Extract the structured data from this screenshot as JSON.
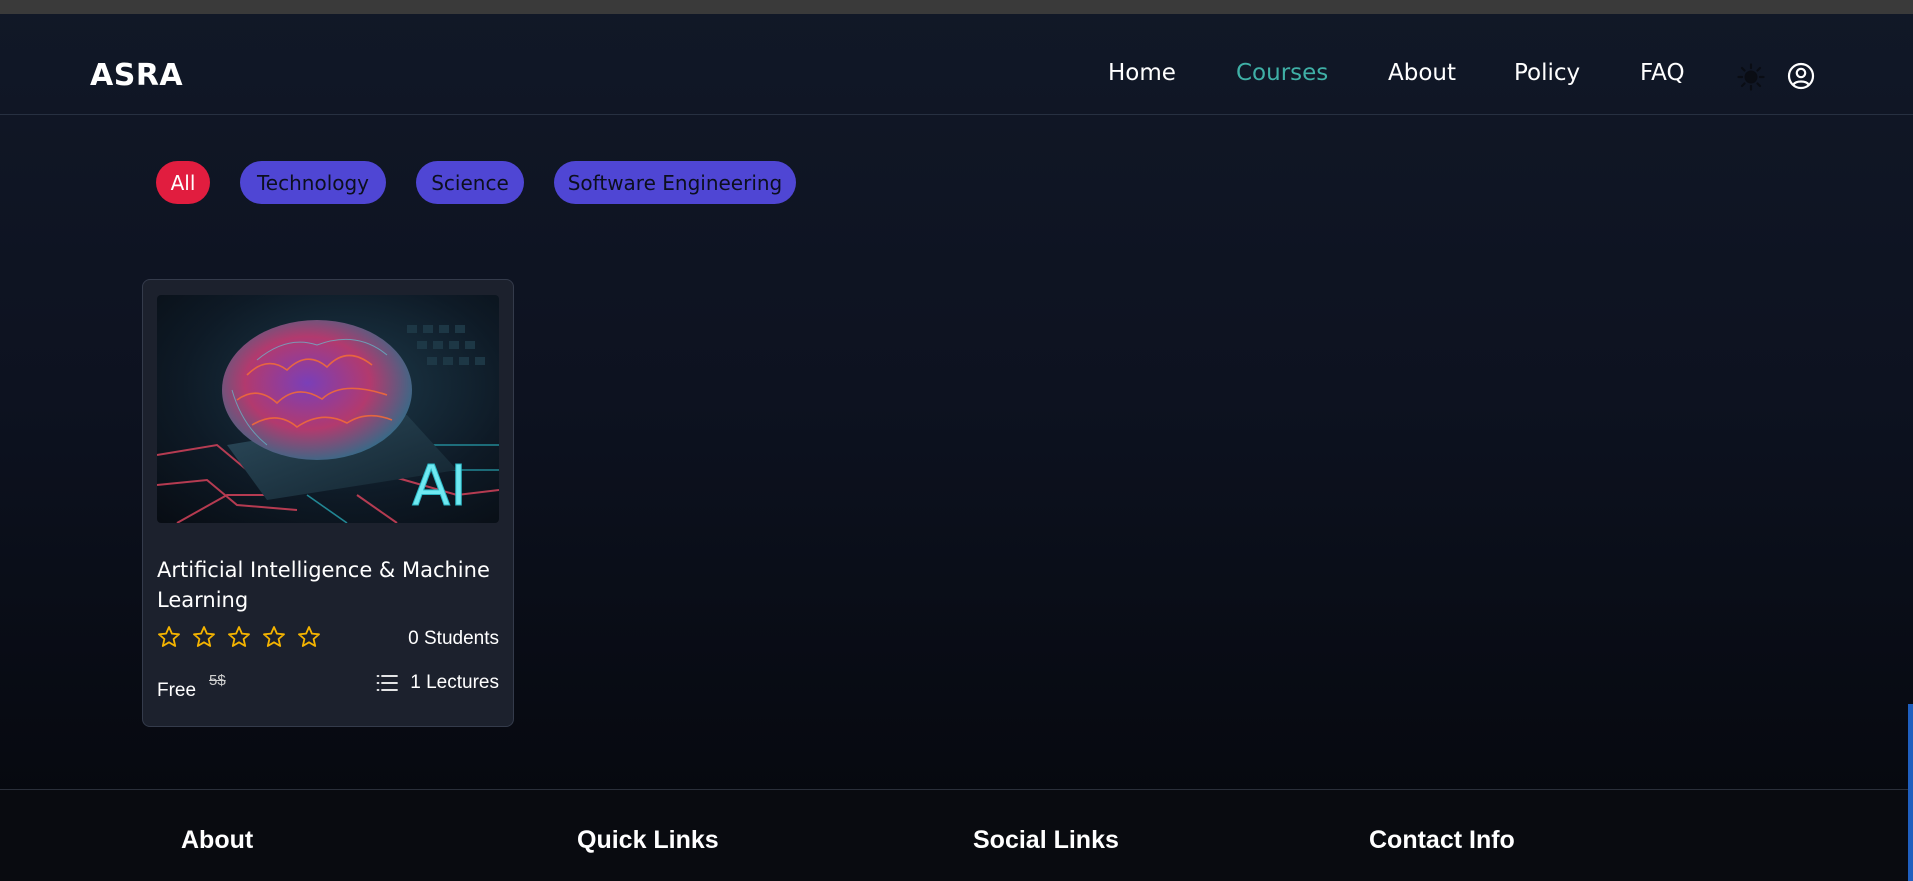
{
  "header": {
    "logo": "ASRA",
    "nav": [
      {
        "label": "Home",
        "active": false
      },
      {
        "label": "Courses",
        "active": true
      },
      {
        "label": "About",
        "active": false
      },
      {
        "label": "Policy",
        "active": false
      },
      {
        "label": "FAQ",
        "active": false
      }
    ],
    "icons": [
      "sun-icon",
      "user-circle-icon"
    ]
  },
  "filters": [
    {
      "label": "All",
      "active": true
    },
    {
      "label": "Technology",
      "active": false
    },
    {
      "label": "Science",
      "active": false
    },
    {
      "label": "Software Engineering",
      "active": false
    }
  ],
  "course": {
    "title": "Artificial Intelligence & Machine Learning",
    "image_text": "AI",
    "rating": 0,
    "rating_max": 5,
    "students": "0 Students",
    "price": "Free",
    "old_price": "5$",
    "lectures": "1 Lectures"
  },
  "footer": {
    "about": "About",
    "quick_links": "Quick Links",
    "social_links": "Social Links",
    "contact_info": "Contact Info"
  },
  "colors": {
    "accent": "#3fb0a6",
    "chip": "#4f46d4",
    "chip_active": "#e11d3f",
    "star": "#f5b400"
  }
}
